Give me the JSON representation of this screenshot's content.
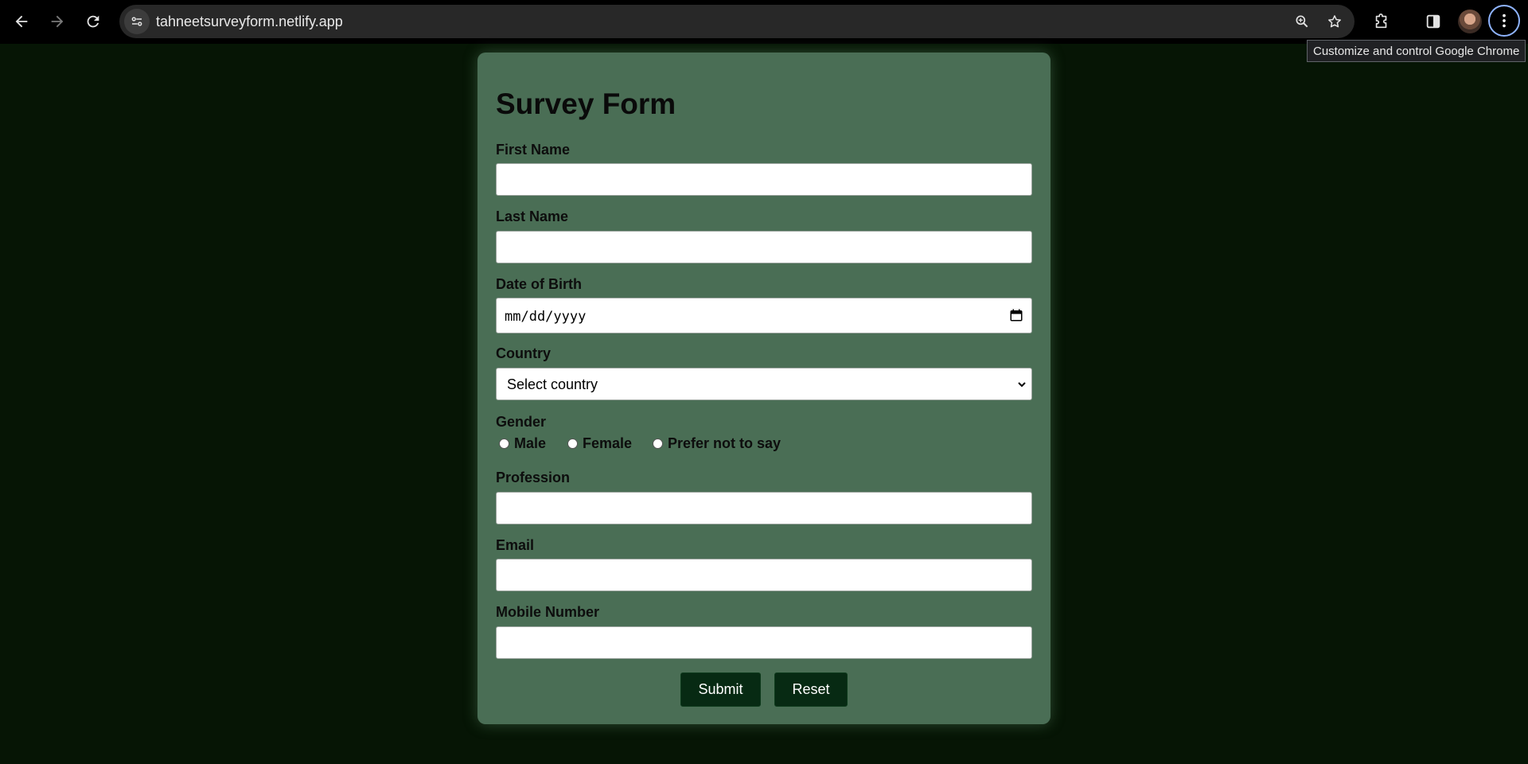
{
  "browser": {
    "url": "tahneetsurveyform.netlify.app",
    "tooltip": "Customize and control Google Chrome",
    "icons": [
      "back-arrow-icon",
      "forward-arrow-icon",
      "reload-icon",
      "site-info-icon",
      "zoom-icon",
      "bookmark-star-icon",
      "extensions-icon",
      "side-panel-icon",
      "profile-avatar",
      "kebab-menu-icon"
    ]
  },
  "form": {
    "title": "Survey Form",
    "first_name_label": "First Name",
    "last_name_label": "Last Name",
    "dob_label": "Date of Birth",
    "dob_placeholder": "mm/dd/yyyy",
    "country_label": "Country",
    "country_selected": "Select country",
    "gender_label": "Gender",
    "gender_options": [
      "Male",
      "Female",
      "Prefer not to say"
    ],
    "profession_label": "Profession",
    "email_label": "Email",
    "mobile_label": "Mobile Number",
    "submit_label": "Submit",
    "reset_label": "Reset"
  },
  "colors": {
    "page_bg": "#061505",
    "card_bg": "#4a6e55",
    "button_bg": "#072a13"
  }
}
